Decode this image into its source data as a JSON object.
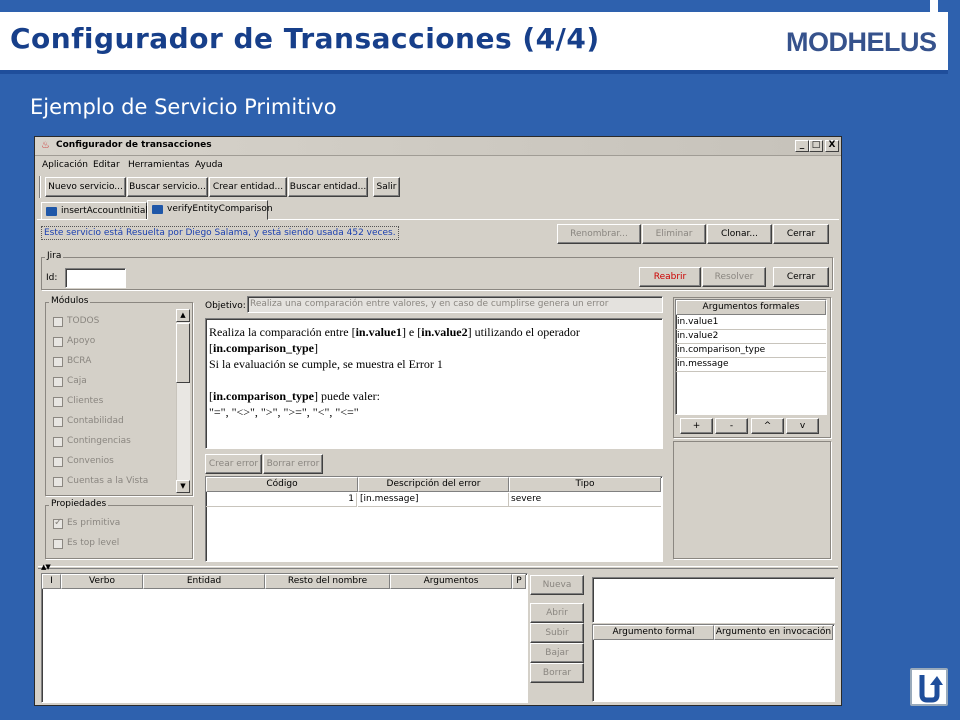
{
  "slide": {
    "title": "Configurador de Transacciones (4/4)",
    "logo": "MODHELUS",
    "subtitle": "Ejemplo de Servicio Primitivo",
    "colors": {
      "background": "#2e61ae",
      "title": "#173f8a",
      "accent": "#1f4e9b"
    }
  },
  "window": {
    "title": "Configurador de transacciones",
    "controls": [
      "_",
      "□",
      "X"
    ],
    "menu": [
      "Aplicación",
      "Editar",
      "Herramientas",
      "Ayuda"
    ],
    "toolbar": [
      "Nuevo servicio...",
      "Buscar servicio...",
      "Crear entidad...",
      "Buscar entidad...",
      "Salir"
    ],
    "tabs": [
      "insertAccountInitial",
      "verifyEntityComparison"
    ],
    "status_text": "Este servicio está Resuelta por Diego Salama, y está siendo usada 452 veces.",
    "service_buttons": [
      "Renombrar...",
      "Eliminar",
      "Clonar...",
      "Cerrar"
    ],
    "jira": {
      "label": "Jira",
      "id_label": "Id:",
      "id_value": "",
      "buttons": [
        "Reabrir",
        "Resolver",
        "Cerrar"
      ]
    },
    "modulos": {
      "label": "Módulos",
      "items": [
        "TODOS",
        "Apoyo",
        "BCRA",
        "Caja",
        "Clientes",
        "Contabilidad",
        "Contingencias",
        "Convenios",
        "Cuentas a la Vista"
      ]
    },
    "propiedades": {
      "label": "Propiedades",
      "items": [
        {
          "label": "Es primitiva",
          "checked": true
        },
        {
          "label": "Es top level",
          "checked": false
        }
      ]
    },
    "objetivo": {
      "label": "Objetivo:",
      "placeholder": "Realiza una comparación entre valores, y en caso de cumplirse genera un error"
    },
    "description": {
      "l1a": "Realiza la comparación entre [",
      "l1b": "in.value1",
      "l1c": "] e [",
      "l1d": "in.value2",
      "l1e": "] utilizando el operador",
      "l2a": "[",
      "l2b": "in.comparison_type",
      "l2c": "]",
      "l3": "Si la evaluación se cumple, se muestra el Error 1",
      "l5a": "[",
      "l5b": "in.comparison_type",
      "l5c": "] puede valer:",
      "l6": "\"=\", \"<>\", \">\", \">=\", \"<\", \"<=\""
    },
    "error_buttons": [
      "Crear error",
      "Borrar error"
    ],
    "errors_table": {
      "columns": [
        "Código",
        "Descripción del error",
        "Tipo"
      ],
      "rows": [
        [
          "1",
          "[in.message]",
          "severe"
        ]
      ]
    },
    "argumentos": {
      "header": "Argumentos formales",
      "items": [
        "in.value1",
        "in.value2",
        "in.comparison_type",
        "in.message"
      ],
      "buttons": [
        "+",
        "-",
        "^",
        "v"
      ]
    },
    "steps_table": {
      "columns": [
        "I",
        "Verbo",
        "Entidad",
        "Resto del nombre",
        "Argumentos",
        "P"
      ]
    },
    "step_buttons": [
      "Nueva",
      "Abrir",
      "Subir",
      "Bajar",
      "Borrar"
    ],
    "args_mapping": {
      "columns": [
        "Argumento formal",
        "Argumento en invocación"
      ]
    }
  },
  "nav": {
    "icon": "return-icon"
  }
}
